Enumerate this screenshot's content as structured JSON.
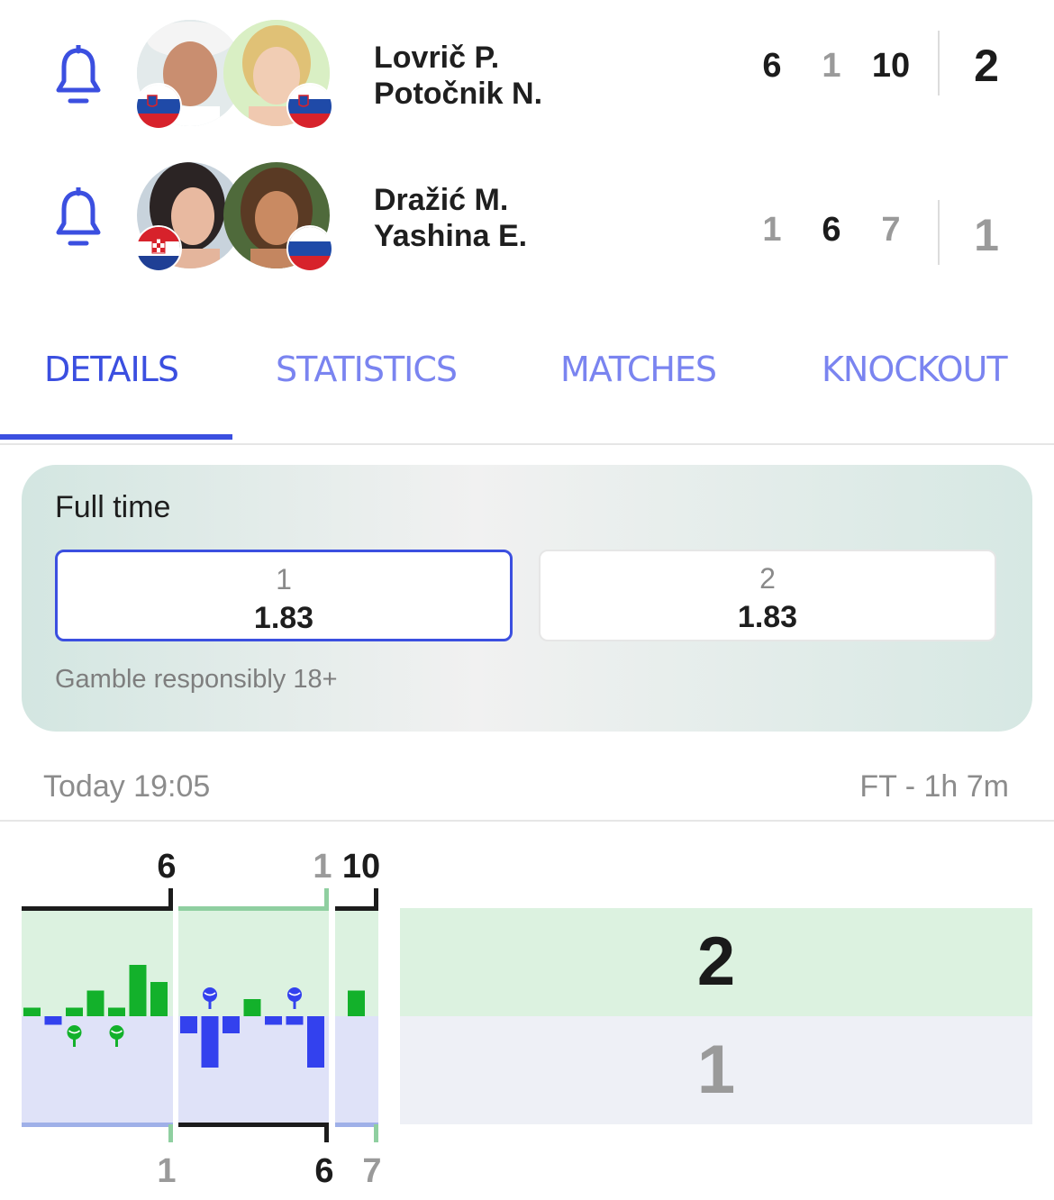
{
  "match": {
    "home": {
      "players": [
        "Lovrič P.",
        "Potočnik N."
      ],
      "flags": [
        "slovenia",
        "slovenia"
      ],
      "sets": [
        6,
        1,
        10
      ],
      "total": 2
    },
    "away": {
      "players": [
        "Dražić M.",
        "Yashina E."
      ],
      "flags": [
        "croatia",
        "russia"
      ],
      "sets": [
        1,
        6,
        7
      ],
      "total": 1
    },
    "set_winner": [
      "home",
      "away",
      "home"
    ]
  },
  "icons": {
    "bell": "bell-icon"
  },
  "tabs": [
    {
      "label": "DETAILS",
      "active": true
    },
    {
      "label": "STATISTICS",
      "active": false
    },
    {
      "label": "MATCHES",
      "active": false
    },
    {
      "label": "KNOCKOUT",
      "active": false
    }
  ],
  "odds": {
    "title": "Full time",
    "options": [
      {
        "label": "1",
        "value": "1.83",
        "selected": true
      },
      {
        "label": "2",
        "value": "1.83",
        "selected": false
      }
    ],
    "disclaimer": "Gamble responsibly 18+"
  },
  "meta": {
    "start": "Today 19:05",
    "status": "FT - 1h 7m"
  },
  "momentum": {
    "home_sets": [
      "6",
      "1",
      "10"
    ],
    "away_sets": [
      "1",
      "6",
      "7"
    ],
    "set_bars": [
      [
        1,
        -1,
        1,
        3,
        1,
        6,
        4
      ],
      [
        -2,
        -6,
        -2,
        2,
        -1,
        -1,
        -6
      ],
      [
        3
      ]
    ],
    "breaks": [
      {
        "set": 0,
        "bar": 2,
        "side": "home"
      },
      {
        "set": 0,
        "bar": 4,
        "side": "home"
      },
      {
        "set": 1,
        "bar": 1,
        "side": "away"
      },
      {
        "set": 1,
        "bar": 5,
        "side": "away"
      }
    ]
  },
  "colors": {
    "accent": "#3b4fe0",
    "home_bar": "#13b12b",
    "away_bar": "#3341ee",
    "home_bg": "#dcf2e0",
    "away_bg": "#dfe2f8"
  }
}
